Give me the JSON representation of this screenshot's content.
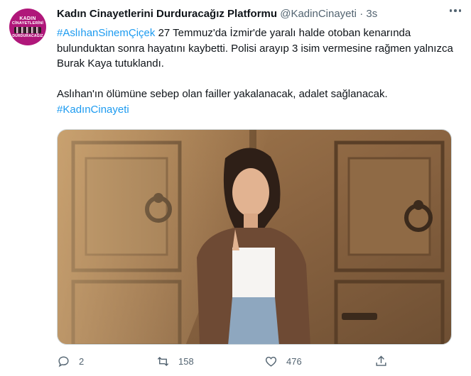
{
  "tweet": {
    "author_name": "Kadın Cinayetlerini Durduracağız Platformu",
    "handle": "@KadinCinayeti",
    "separator": "·",
    "time": "3s",
    "avatar_text": [
      "KADIN",
      "CİNAYETLERİNİ",
      "DURDURACAĞIZ"
    ],
    "text_hashtag1": "#AslıhanSinemÇiçek",
    "text_part1": " 27 Temmuz'da İzmir'de yaralı halde otoban kenarında bulunduktan sonra hayatını kaybetti. Polisi arayıp 3 isim vermesine rağmen yalnızca Burak Kaya tutuklandı.",
    "text_part2": "Aslıhan'ın ölümüne sebep olan failler yakalanacak, adalet sağlanacak.",
    "text_hashtag2": "#KadınCinayeti"
  },
  "actions": {
    "reply": {
      "icon": "reply-icon",
      "count": "2"
    },
    "retweet": {
      "icon": "retweet-icon",
      "count": "158"
    },
    "like": {
      "icon": "heart-icon",
      "count": "476"
    },
    "share": {
      "icon": "share-icon"
    }
  },
  "colors": {
    "link": "#1d9bf0",
    "muted": "#536471",
    "text": "#0f1419",
    "avatar_bg": "#b0177a"
  }
}
